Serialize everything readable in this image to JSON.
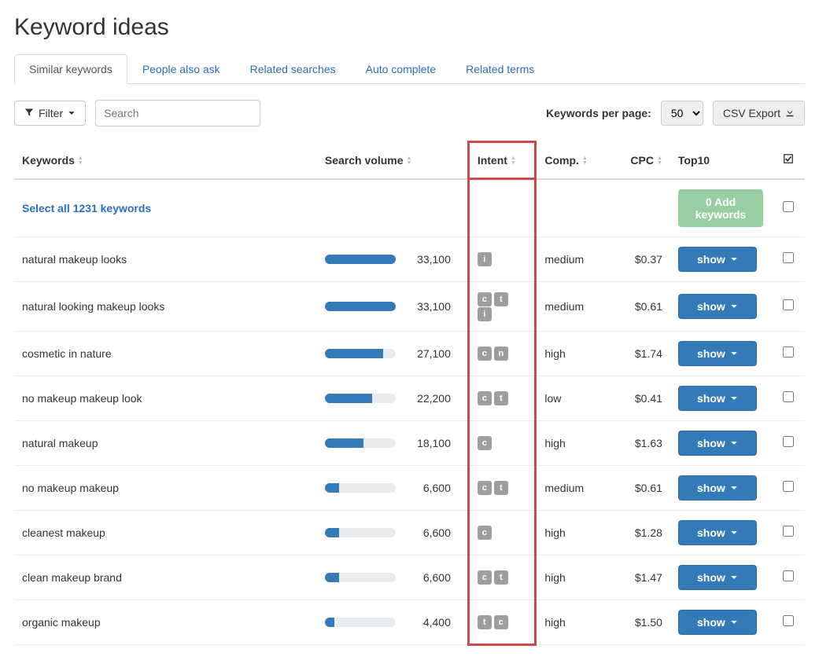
{
  "title": "Keyword ideas",
  "tabs": [
    {
      "label": "Similar keywords",
      "active": true
    },
    {
      "label": "People also ask",
      "active": false
    },
    {
      "label": "Related searches",
      "active": false
    },
    {
      "label": "Auto complete",
      "active": false
    },
    {
      "label": "Related terms",
      "active": false
    }
  ],
  "toolbar": {
    "filter_label": "Filter",
    "search_placeholder": "Search",
    "per_page_label": "Keywords per page:",
    "per_page_value": "50",
    "export_label": "CSV Export"
  },
  "columns": {
    "keywords": "Keywords",
    "volume": "Search volume",
    "intent": "Intent",
    "comp": "Comp.",
    "cpc": "CPC",
    "top10": "Top10"
  },
  "select_all": "Select all 1231 keywords",
  "add_keywords_label": "0 Add keywords",
  "show_label": "show",
  "max_volume": 33100,
  "rows": [
    {
      "keyword": "natural makeup looks",
      "volume": 33100,
      "volume_fmt": "33,100",
      "intent": [
        "i"
      ],
      "comp": "medium",
      "cpc": "$0.37"
    },
    {
      "keyword": "natural looking makeup looks",
      "volume": 33100,
      "volume_fmt": "33,100",
      "intent": [
        "c",
        "t",
        "i"
      ],
      "comp": "medium",
      "cpc": "$0.61"
    },
    {
      "keyword": "cosmetic in nature",
      "volume": 27100,
      "volume_fmt": "27,100",
      "intent": [
        "c",
        "n"
      ],
      "comp": "high",
      "cpc": "$1.74"
    },
    {
      "keyword": "no makeup makeup look",
      "volume": 22200,
      "volume_fmt": "22,200",
      "intent": [
        "c",
        "t"
      ],
      "comp": "low",
      "cpc": "$0.41"
    },
    {
      "keyword": "natural makeup",
      "volume": 18100,
      "volume_fmt": "18,100",
      "intent": [
        "c"
      ],
      "comp": "high",
      "cpc": "$1.63"
    },
    {
      "keyword": "no makeup makeup",
      "volume": 6600,
      "volume_fmt": "6,600",
      "intent": [
        "c",
        "t"
      ],
      "comp": "medium",
      "cpc": "$0.61"
    },
    {
      "keyword": "cleanest makeup",
      "volume": 6600,
      "volume_fmt": "6,600",
      "intent": [
        "c"
      ],
      "comp": "high",
      "cpc": "$1.28"
    },
    {
      "keyword": "clean makeup brand",
      "volume": 6600,
      "volume_fmt": "6,600",
      "intent": [
        "c",
        "t"
      ],
      "comp": "high",
      "cpc": "$1.47"
    },
    {
      "keyword": "organic makeup",
      "volume": 4400,
      "volume_fmt": "4,400",
      "intent": [
        "t",
        "c"
      ],
      "comp": "high",
      "cpc": "$1.50"
    }
  ]
}
